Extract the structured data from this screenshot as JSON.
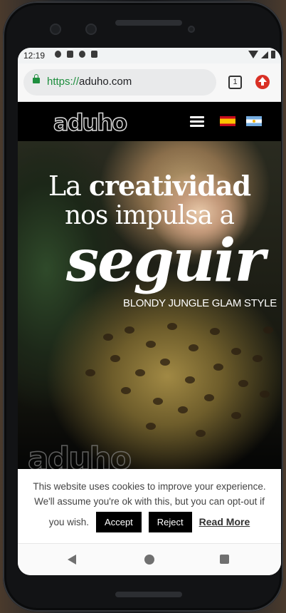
{
  "status_bar": {
    "time": "12:19"
  },
  "browser": {
    "url_scheme": "https://",
    "url_domain": "aduho.com",
    "tab_count": "1"
  },
  "site_header": {
    "logo": "aduho"
  },
  "hero": {
    "line1_normal": "La ",
    "line1_bold": "creatividad",
    "line2": "nos impulsa a",
    "emphasis": "seguir",
    "tagline": "BLONDY JUNGLE GLAM STYLE"
  },
  "footer_logo": "aduho",
  "cookie_notice": {
    "message": "This website uses cookies to improve your experience. We'll assume you're ok with this, but you can opt-out if",
    "message_end": "you wish.",
    "accept_label": "Accept",
    "reject_label": "Reject",
    "read_more_label": "Read More"
  },
  "colors": {
    "secure_green": "#1e8e3e",
    "alert_red": "#d93025"
  }
}
